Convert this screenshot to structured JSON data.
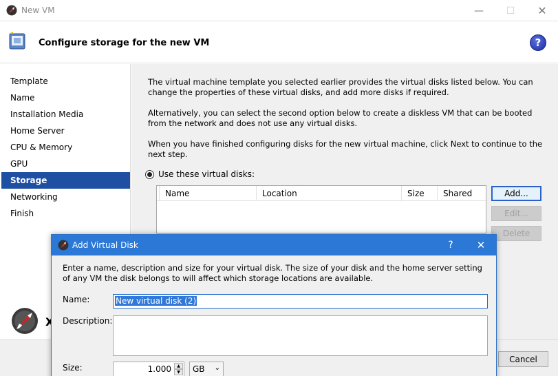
{
  "window": {
    "title": "New VM",
    "minimize_glyph": "—",
    "maximize_glyph": "☐",
    "close_glyph": "✕",
    "app_icon": "xencenter-logo-icon"
  },
  "header": {
    "heading": "Configure storage for the new VM",
    "help_label": "?",
    "icon": "wizard-monitor-icon"
  },
  "nav": {
    "items": [
      {
        "label": "Template"
      },
      {
        "label": "Name"
      },
      {
        "label": "Installation Media"
      },
      {
        "label": "Home Server"
      },
      {
        "label": "CPU & Memory"
      },
      {
        "label": "GPU"
      },
      {
        "label": "Storage",
        "active": true
      },
      {
        "label": "Networking"
      },
      {
        "label": "Finish"
      }
    ],
    "logo_text": "X"
  },
  "content": {
    "para1": "The virtual machine template you selected earlier provides the virtual disks listed below. You can change the properties of these virtual disks, and add more disks if required.",
    "para2": "Alternatively, you can select the second option below to create a diskless VM that can be booted from the network and does not use any virtual disks.",
    "para3": "When you have finished configuring disks for the new virtual machine, click Next to continue to the next step.",
    "radio_label": "Use these virtual disks:",
    "table_columns": [
      "Name",
      "Location",
      "Size",
      "Shared"
    ],
    "buttons": {
      "add": "Add...",
      "edit": "Edit...",
      "delete": "Delete"
    }
  },
  "footer": {
    "cancel": "Cancel"
  },
  "dialog": {
    "title": "Add Virtual Disk",
    "help_glyph": "?",
    "close_glyph": "✕",
    "description": "Enter a name, description and size for your virtual disk. The size of your disk and the home server setting of any VM the disk belongs to will affect which storage locations are available.",
    "name_label": "Name:",
    "name_value": "New virtual disk (2)",
    "description_label": "Description:",
    "size_label": "Size:",
    "size_value": "1.000",
    "size_unit": "GB"
  },
  "colors": {
    "accent": "#2b78d6",
    "nav_active": "#1f4fa3",
    "help": "#1c2f9e"
  }
}
